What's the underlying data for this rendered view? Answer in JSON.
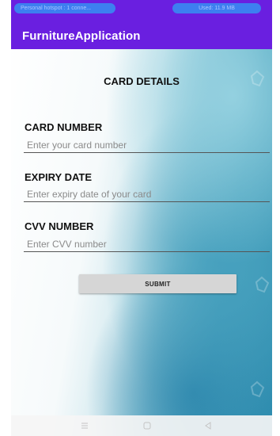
{
  "status_bar": {
    "left_pill": "Personal hotspot : 1 conne...",
    "right_pill": "Used: 11.9 MB"
  },
  "app_bar": {
    "title": "FurnitureApplication"
  },
  "form": {
    "title": "CARD DETAILS",
    "card_number": {
      "label": "CARD NUMBER",
      "placeholder": "Enter your card number"
    },
    "expiry_date": {
      "label": "EXPIRY DATE",
      "placeholder": "Enter expiry date of your card"
    },
    "cvv_number": {
      "label": "CVV NUMBER",
      "placeholder": "Enter CVV number"
    },
    "submit_label": "SUBMIT"
  },
  "nav_bar": {
    "icons": [
      "menu-icon",
      "home-icon",
      "back-icon"
    ]
  },
  "colors": {
    "app_bar": "#6a1fe0",
    "status_pill": "#3d7ff0"
  }
}
